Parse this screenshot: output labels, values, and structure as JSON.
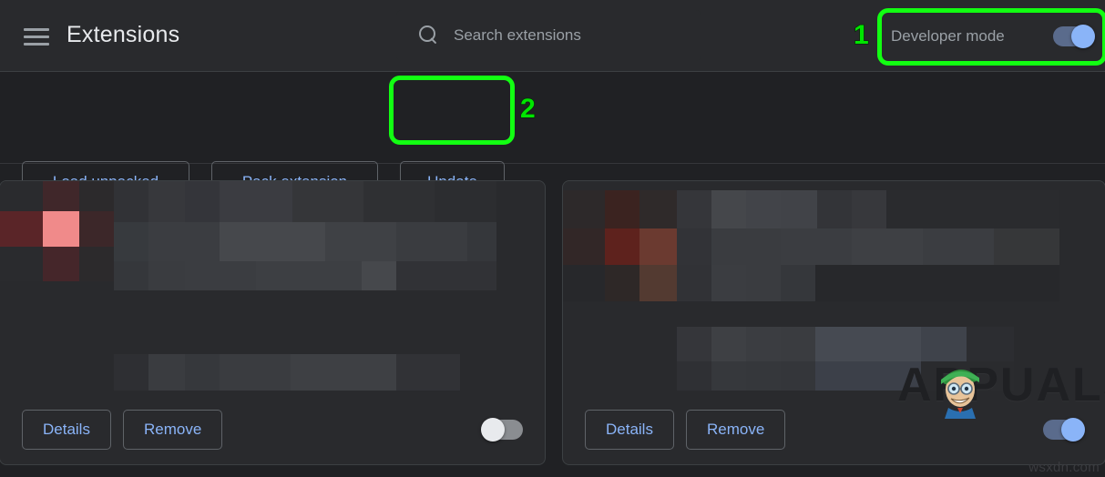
{
  "window": {
    "title": "Extensions",
    "background_color": "#202124"
  },
  "header": {
    "menu_icon": "hamburger-menu-icon",
    "title": "Extensions",
    "search": {
      "icon": "search-icon",
      "placeholder": "Search extensions",
      "value": ""
    },
    "developer_mode": {
      "label": "Developer mode",
      "toggle_state": "on",
      "toggle_color": "#8ab4f8"
    }
  },
  "callouts": [
    {
      "number": "1",
      "target": "developer-mode",
      "color": "#12ff12"
    },
    {
      "number": "2",
      "target": "update-button",
      "color": "#12ff12"
    }
  ],
  "toolbar": {
    "load_unpacked_label": "Load unpacked",
    "pack_extension_label": "Pack extension",
    "update_label": "Update",
    "link_color": "#8ab4f8"
  },
  "cards": [
    {
      "name": "extension-card-1",
      "icon_state": "pixelated",
      "name_state": "pixelated",
      "description_state": "pixelated",
      "details_label": "Details",
      "remove_label": "Remove",
      "enabled_label": "",
      "toggle_state": "off"
    },
    {
      "name": "extension-card-2",
      "icon_state": "pixelated",
      "name_state": "pixelated",
      "description_state": "pixelated",
      "details_label": "Details",
      "remove_label": "Remove",
      "enabled_label": "",
      "toggle_state": "on"
    }
  ],
  "watermarks": {
    "brand": "APPUALS",
    "site": "wsxdn.com",
    "mascot": "appuals-mascot-icon"
  }
}
